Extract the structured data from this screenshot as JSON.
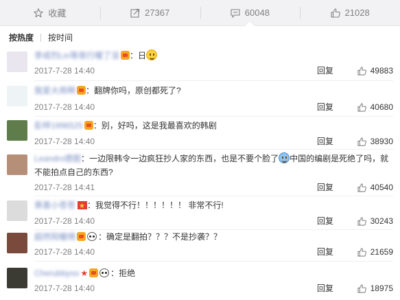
{
  "action_bar": {
    "favorite_label": "收藏",
    "forward_count": "27367",
    "comment_count": "60048",
    "like_count": "21028"
  },
  "sort": {
    "hot": "按热度",
    "time": "按时间"
  },
  "reply_label": "回复",
  "comments": [
    {
      "user": "李成烈Lin等夜行喔了没",
      "text": "日",
      "time": "2017-7-28 14:40",
      "likes": "49883",
      "avatar_color": "#e9e6ef"
    },
    {
      "user": "我爱大雨啊",
      "text": "翻牌你吗，原创都死了?",
      "time": "2017-7-28 14:40",
      "likes": "40680",
      "avatar_color": "#eef3f5"
    },
    {
      "user": "彭梓1996525",
      "text": "别，好吗，这是我最喜欢的韩剧",
      "time": "2017-7-28 14:40",
      "likes": "38930",
      "avatar_color": "#5f7d4a"
    },
    {
      "user": "Leandro德图",
      "text_a": "一边限韩令一边疯狂抄人家的东西，也是不要个脸了",
      "text_b": "中国的编剧是死绝了吗，就不能拍点自己的东西?",
      "time": "2017-7-28 14:41",
      "likes": "40540",
      "avatar_color": "#b68f78"
    },
    {
      "user": "萧墨小苍苍",
      "text": "我觉得不行！！！！！！ 非常不行!",
      "time": "2017-7-28 14:40",
      "likes": "30243",
      "avatar_color": "#dcdcdc"
    },
    {
      "user": "超然阳暖晴",
      "text": "确定是翻拍？？？不是抄袭？？",
      "time": "2017-7-28 14:40",
      "likes": "21659",
      "avatar_color": "#7a4a3c"
    },
    {
      "user": "Cherubbyoo",
      "text": "拒绝",
      "time": "2017-7-28 14:40",
      "likes": "18975",
      "avatar_color": "#3b3a33"
    }
  ],
  "colors": {
    "bar_bg": "#f2f2f5",
    "username": "#eb7350",
    "meta": "#808080"
  }
}
